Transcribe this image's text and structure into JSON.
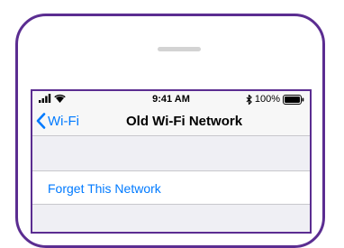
{
  "statusbar": {
    "time": "9:41 AM",
    "battery_percent": "100%"
  },
  "navbar": {
    "back_label": "Wi-Fi",
    "title": "Old Wi-Fi Network"
  },
  "actions": {
    "forget_label": "Forget This Network"
  },
  "colors": {
    "accent": "#007aff",
    "device_outline": "#5b2d91"
  }
}
